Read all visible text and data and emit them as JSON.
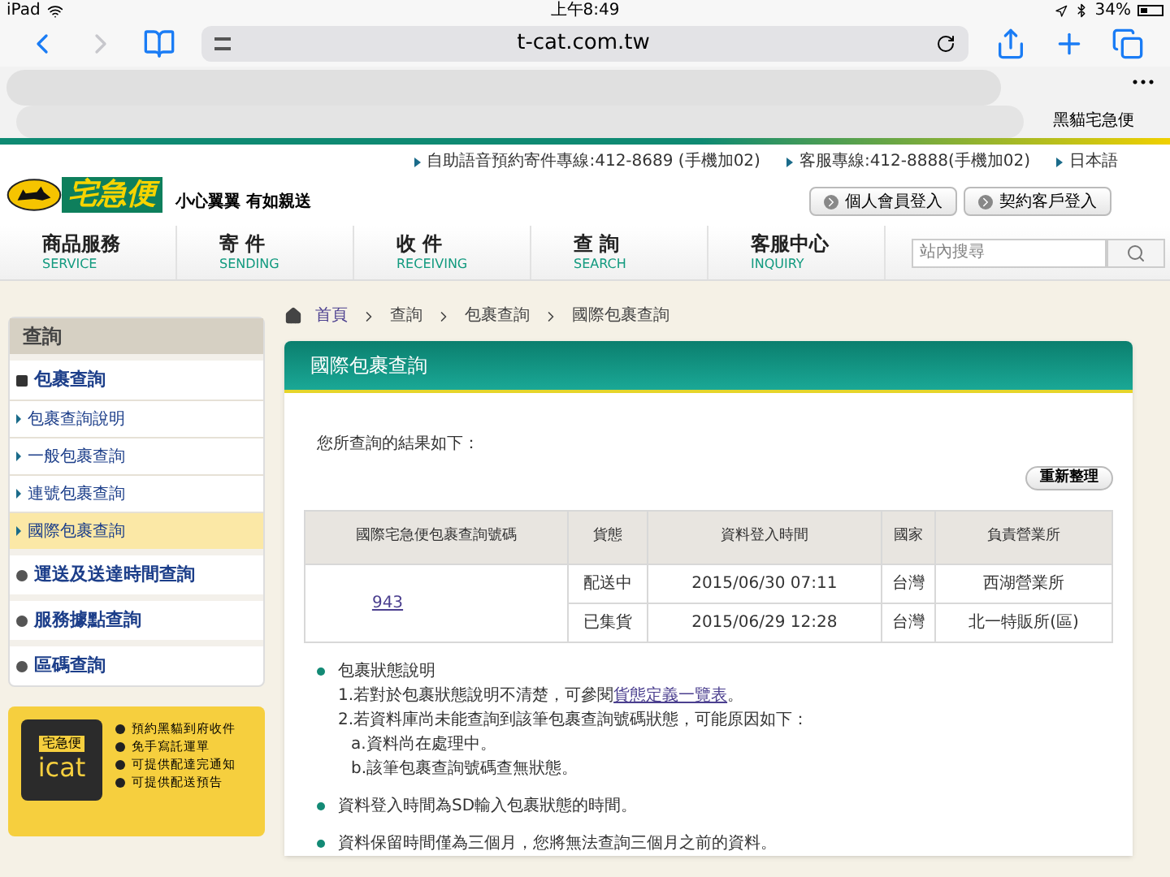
{
  "status_bar": {
    "device": "iPad",
    "time": "上午8:49",
    "battery": "34%"
  },
  "browser": {
    "url": "t-cat.com.tw",
    "tab_title": "黑貓宅急便"
  },
  "header": {
    "logo_text": "宅急便",
    "tagline": "小心翼翼 有如親送",
    "top_links": [
      "自助語音預約寄件專線:412-8689 (手機加02)",
      "客服專線:412-8888(手機加02)",
      "日本語"
    ],
    "login_buttons": [
      "個人會員登入",
      "契約客戶登入"
    ],
    "nav": [
      {
        "label": "商品服務",
        "sublabel": "SERVICE"
      },
      {
        "label": "寄 件",
        "sublabel": "SENDING"
      },
      {
        "label": "收 件",
        "sublabel": "RECEIVING"
      },
      {
        "label": "查 詢",
        "sublabel": "SEARCH"
      },
      {
        "label": "客服中心",
        "sublabel": "INQUIRY"
      }
    ],
    "search": {
      "placeholder": "站內搜尋"
    }
  },
  "sidebar": {
    "title": "查詢",
    "sections": [
      {
        "label": "包裹查詢",
        "expanded": true,
        "children": [
          {
            "label": "包裹查詢說明",
            "selected": false
          },
          {
            "label": "一般包裹查詢",
            "selected": false
          },
          {
            "label": "連號包裹查詢",
            "selected": false
          },
          {
            "label": "國際包裹查詢",
            "selected": true
          }
        ]
      },
      {
        "label": "運送及送達時間查詢",
        "expanded": false
      },
      {
        "label": "服務據點查詢",
        "expanded": false
      },
      {
        "label": "區碼查詢",
        "expanded": false
      }
    ]
  },
  "promo": {
    "brand": "宅急便",
    "name": "icat",
    "features": [
      "預約黑貓到府收件",
      "免手寫託運單",
      "可提供配達完通知",
      "可提供配送預告"
    ]
  },
  "breadcrumb": [
    "首頁",
    "查詢",
    "包裹查詢",
    "國際包裹查詢"
  ],
  "panel": {
    "title": "國際包裹查詢",
    "intro": "您所查詢的結果如下：",
    "refresh_button": "重新整理",
    "table": {
      "columns": [
        "國際宅急便包裹查詢號碼",
        "貨態",
        "資料登入時間",
        "國家",
        "負責營業所"
      ],
      "tracking_number": "943",
      "rows": [
        {
          "status": "配送中",
          "time": "2015/06/30 07:11",
          "country": "台灣",
          "office": "西湖營業所"
        },
        {
          "status": "已集貨",
          "time": "2015/06/29 12:28",
          "country": "台灣",
          "office": "北一特販所(區)"
        }
      ]
    },
    "notes": [
      {
        "title": "包裹狀態說明",
        "lines": [
          {
            "before": "1.若對於包裹狀態說明不清楚，可參閱",
            "link": "貨態定義一覽表",
            "after": "。"
          },
          {
            "before": "2.若資料庫尚未能查詢到該筆包裹查詢號碼狀態，可能原因如下："
          }
        ],
        "sublines": [
          "a.資料尚在處理中。",
          "b.該筆包裹查詢號碼查無狀態。"
        ]
      },
      {
        "title": "資料登入時間為SD輸入包裹狀態的時間。"
      },
      {
        "title": "資料保留時間僅為三個月，您將無法查詢三個月之前的資料。"
      }
    ]
  }
}
